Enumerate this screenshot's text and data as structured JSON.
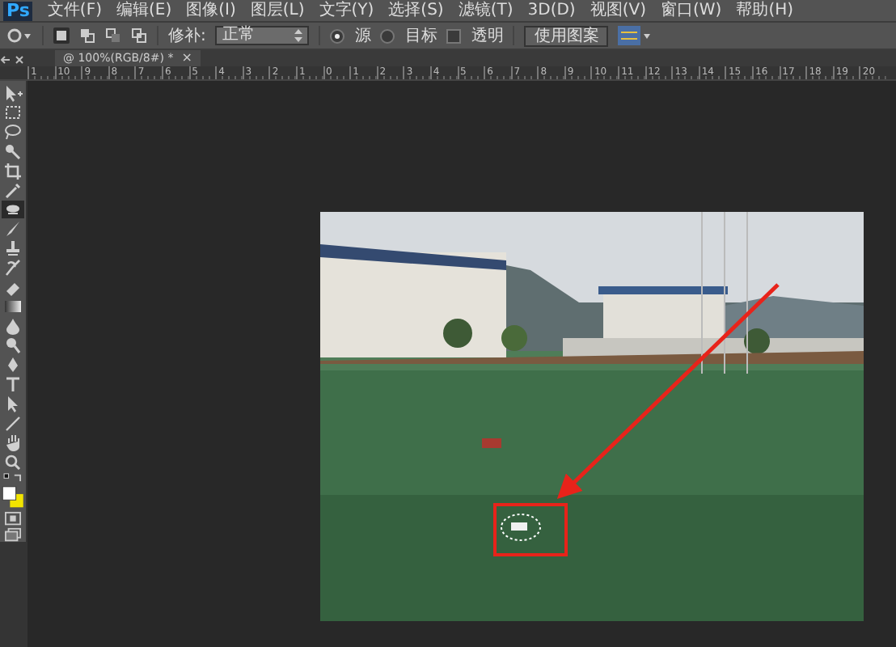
{
  "app": {
    "logo": "Ps"
  },
  "menu": [
    "文件(F)",
    "编辑(E)",
    "图像(I)",
    "图层(L)",
    "文字(Y)",
    "选择(S)",
    "滤镜(T)",
    "3D(D)",
    "视图(V)",
    "窗口(W)",
    "帮助(H)"
  ],
  "options_bar": {
    "modes": [
      {
        "kind": "new",
        "selected": true
      },
      {
        "kind": "add",
        "selected": false
      },
      {
        "kind": "subtract",
        "selected": false
      },
      {
        "kind": "intersect",
        "selected": false
      }
    ],
    "patch_label": "修补:",
    "patch_value": "正常",
    "radios": [
      {
        "label": "源",
        "selected": true
      },
      {
        "label": "目标",
        "selected": false
      }
    ],
    "transparent": {
      "label": "透明",
      "checked": false
    },
    "button": "使用图案"
  },
  "document_tab": {
    "title": "@ 100%(RGB/8#) *",
    "close": "×"
  },
  "ruler": [
    "1",
    "10",
    "9",
    "8",
    "7",
    "6",
    "5",
    "4",
    "3",
    "2",
    "1",
    "0",
    "1",
    "2",
    "3",
    "4",
    "5",
    "6",
    "7",
    "8",
    "9",
    "10",
    "11",
    "12",
    "13",
    "14",
    "15",
    "16",
    "17",
    "18",
    "19",
    "20"
  ],
  "tools": [
    {
      "kind": "move",
      "selected": false
    },
    {
      "kind": "marquee",
      "selected": false
    },
    {
      "kind": "lasso",
      "selected": false
    },
    {
      "kind": "wand",
      "selected": false
    },
    {
      "kind": "crop",
      "selected": false
    },
    {
      "kind": "eyedropper",
      "selected": false
    },
    {
      "kind": "patch",
      "selected": true
    },
    {
      "kind": "brush",
      "selected": false
    },
    {
      "kind": "stamp",
      "selected": false
    },
    {
      "kind": "history",
      "selected": false
    },
    {
      "kind": "eraser",
      "selected": false
    },
    {
      "kind": "gradient",
      "selected": false
    },
    {
      "kind": "blur",
      "selected": false
    },
    {
      "kind": "dodge",
      "selected": false
    },
    {
      "kind": "pen",
      "selected": false
    },
    {
      "kind": "type",
      "selected": false
    },
    {
      "kind": "select",
      "selected": false
    },
    {
      "kind": "line",
      "selected": false
    },
    {
      "kind": "hand",
      "selected": false
    },
    {
      "kind": "zoom",
      "selected": false
    }
  ]
}
